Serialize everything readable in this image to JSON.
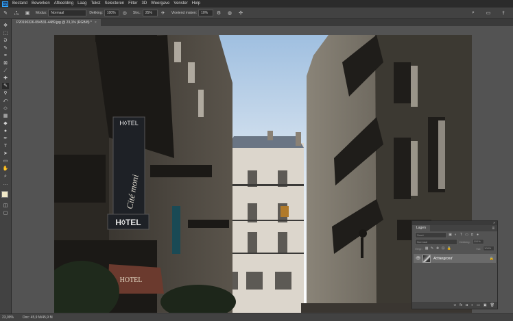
{
  "menubar": {
    "logo": "Ps",
    "items": [
      "Bestand",
      "Bewerken",
      "Afbeelding",
      "Laag",
      "Tekst",
      "Selecteren",
      "Filter",
      "3D",
      "Weergave",
      "Venster",
      "Help"
    ]
  },
  "options": {
    "brush_size": "175",
    "mode_label": "Modus:",
    "mode_value": "Normaal",
    "opacity_label": "Dekking:",
    "opacity_value": "100%",
    "flow_label": "Stro.:",
    "flow_value": "25%",
    "smoothing_label": "Vloeiend maken:",
    "smoothing_value": "10%"
  },
  "document_tab": {
    "title": "P20190326-094531-4489.jpg @ 23,1% (RGB/8) *",
    "close": "×"
  },
  "status": {
    "zoom": "23,09%",
    "doc": "Doc: 45,9 M/45,9 M"
  },
  "layers_panel": {
    "collapse": "»",
    "menu": "≡",
    "tab": "Lagen",
    "filter_placeholder": "Soort",
    "blend_mode": "Normaal",
    "opacity_label": "Dekking:",
    "opacity_value": "100%",
    "lock_label": "Vergr.:",
    "fill_label": "Vul:",
    "fill_value": "100%",
    "layer_name": "Achtergrond",
    "eye": "👁",
    "lock_icon": "🔒",
    "bottom_icons": [
      "∞",
      "fx",
      "◘",
      "◐",
      "▭",
      "▣",
      "🗑"
    ]
  },
  "colors": {
    "foreground": "#f0e8c8",
    "background": "#ffffff",
    "accent": "#31a8ff"
  },
  "canvas_image": {
    "hotel_sign_top": "H◊TEL",
    "hotel_sign_bottom": "H◊TEL",
    "sign_vertical": "Cité moni",
    "hotel_lower": "HOTEL"
  }
}
